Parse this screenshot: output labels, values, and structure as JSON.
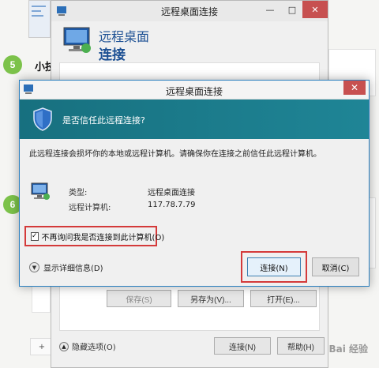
{
  "background": {
    "steps": [
      "5",
      "6"
    ],
    "heading": "小技",
    "plus_label": "+"
  },
  "bg_window": {
    "title": "远程桌面连接",
    "header_line1": "远程桌面",
    "header_line2": "连接",
    "minimize": "—",
    "maximize": "□",
    "close": "✕",
    "buttons": {
      "save": "保存(S)",
      "save_as": "另存为(V)...",
      "open": "打开(E)...",
      "hide_options": "隐藏选项(O)",
      "connect": "连接(N)",
      "help": "帮助(H)"
    }
  },
  "dialog": {
    "title": "远程桌面连接",
    "close": "✕",
    "question": "是否信任此远程连接?",
    "warning": "此远程连接会损坏你的本地或远程计算机。请确保你在连接之前信任此远程计算机。",
    "type_label": "类型:",
    "type_value": "远程桌面连接",
    "computer_label": "远程计算机:",
    "computer_value": "117.78.7.79",
    "checkbox_label": "不再询问我是否连接到此计算机(O)",
    "checkbox_checked": true,
    "details_label": "显示详细信息(D)",
    "connect_button": "连接(N)",
    "cancel_button": "取消(C)"
  },
  "watermark": "Bai 经验",
  "colors": {
    "banner": "#1c7a8c",
    "highlight": "#d43a3a",
    "step_badge": "#7cc24a",
    "title_blue": "#1b4f93"
  }
}
